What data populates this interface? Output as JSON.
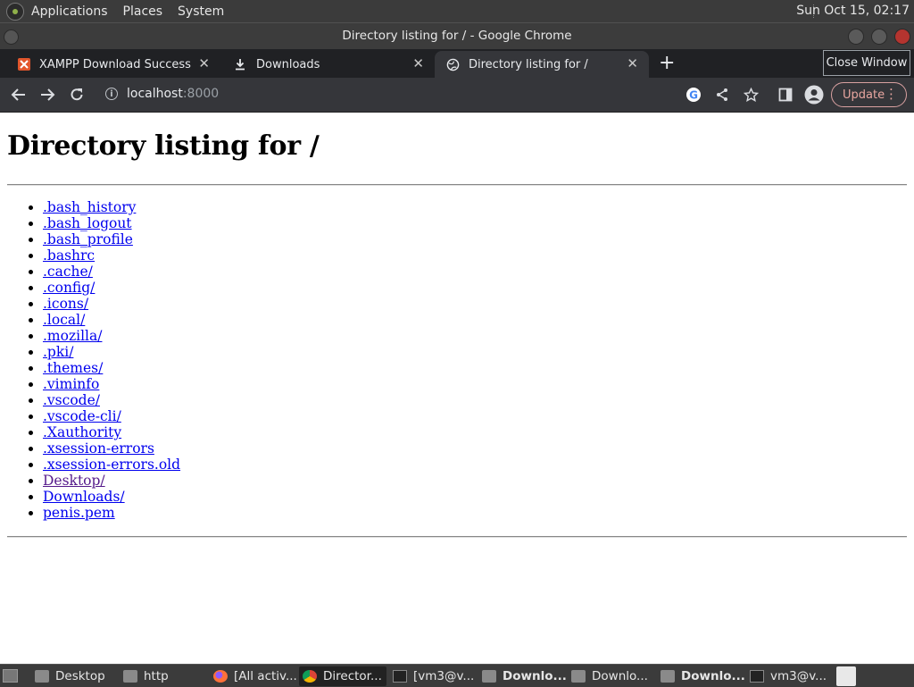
{
  "top_panel": {
    "menus": [
      "Applications",
      "Places",
      "System"
    ],
    "clock": "Sun Oct 15, 02:17"
  },
  "window": {
    "title": "Directory listing for / - Google Chrome"
  },
  "tabs": [
    {
      "label": "XAMPP Download Success",
      "icon": "xampp-icon"
    },
    {
      "label": "Downloads",
      "icon": "download-icon"
    },
    {
      "label": "Directory listing for /",
      "icon": "globe-icon",
      "active": true
    }
  ],
  "tooltip": "Close Window",
  "toolbar": {
    "url_host": "localhost",
    "url_port": ":8000",
    "update_label": "Update"
  },
  "page": {
    "heading": "Directory listing for /",
    "entries": [
      ".bash_history",
      ".bash_logout",
      ".bash_profile",
      ".bashrc",
      ".cache/",
      ".config/",
      ".icons/",
      ".local/",
      ".mozilla/",
      ".pki/",
      ".themes/",
      ".viminfo",
      ".vscode/",
      ".vscode-cli/",
      ".Xauthority",
      ".xsession-errors",
      ".xsession-errors.old",
      "Desktop/",
      "Downloads/",
      "penis.pem"
    ]
  },
  "taskbar": {
    "items": [
      "Desktop",
      "http",
      "[All activ...",
      "Director...",
      "[vm3@v...",
      "Downlo...",
      "Downlo...",
      "Downlo...",
      "vm3@v..."
    ]
  },
  "colors": {
    "link": "#0000ee",
    "visited_link": "#551a8b",
    "chrome_dark": "#202124",
    "update_accent": "#e8a6a0"
  }
}
